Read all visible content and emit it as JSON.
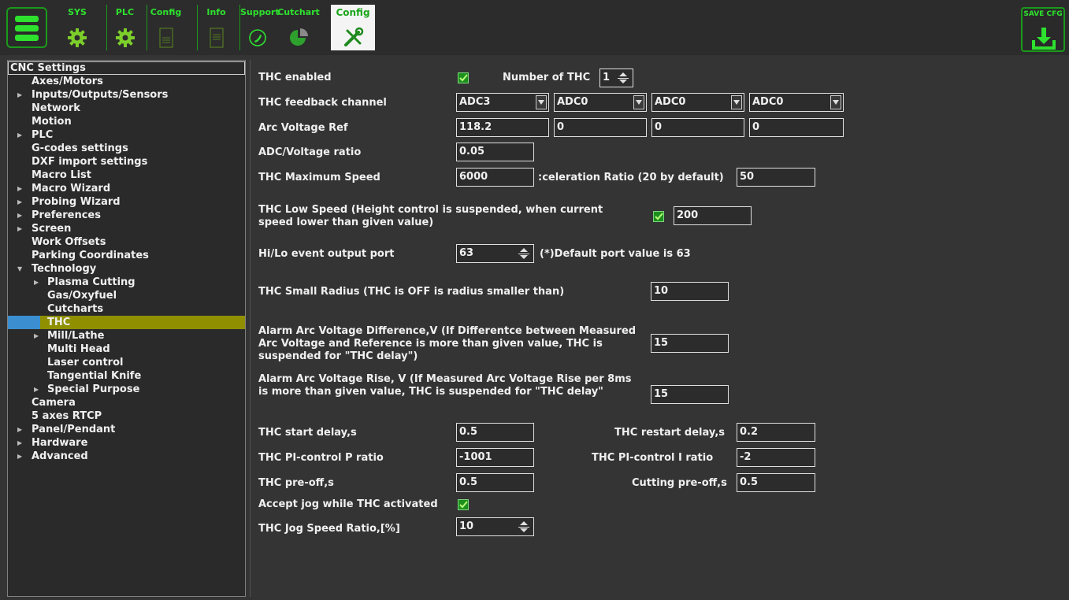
{
  "toolbar": {
    "tabs": [
      {
        "label": "SYS",
        "icon": "gear-icon"
      },
      {
        "label": "PLC",
        "icon": "gear-icon"
      },
      {
        "label": "Config",
        "icon": "document-icon"
      },
      {
        "label": "Info",
        "icon": "document-icon"
      },
      {
        "label": "Support",
        "icon": "phone-icon"
      },
      {
        "label": "Cutchart",
        "icon": "pie-chart-icon"
      },
      {
        "label": "Config",
        "icon": "tools-icon",
        "active": true
      }
    ],
    "save_label": "SAVE CFG"
  },
  "sidebar": {
    "items": [
      {
        "label": "CNC Settings"
      },
      {
        "label": "Axes/Motors"
      },
      {
        "label": "Inputs/Outputs/Sensors"
      },
      {
        "label": "Network"
      },
      {
        "label": "Motion"
      },
      {
        "label": "PLC"
      },
      {
        "label": "G-codes settings"
      },
      {
        "label": "DXF import settings"
      },
      {
        "label": "Macro List"
      },
      {
        "label": "Macro Wizard"
      },
      {
        "label": "Probing Wizard"
      },
      {
        "label": "Preferences"
      },
      {
        "label": "Screen"
      },
      {
        "label": "Work Offsets"
      },
      {
        "label": "Parking Coordinates"
      },
      {
        "label": "Technology"
      },
      {
        "label": "Plasma Cutting"
      },
      {
        "label": "Gas/Oxyfuel"
      },
      {
        "label": "Cutcharts"
      },
      {
        "label": "THC"
      },
      {
        "label": "Mill/Lathe"
      },
      {
        "label": "Multi Head"
      },
      {
        "label": "Laser control"
      },
      {
        "label": "Tangential Knife"
      },
      {
        "label": "Special Purpose"
      },
      {
        "label": "Camera"
      },
      {
        "label": "5 axes RTCP"
      },
      {
        "label": "Panel/Pendant"
      },
      {
        "label": "Hardware"
      },
      {
        "label": "Advanced"
      }
    ]
  },
  "thc": {
    "enabled_label": "THC enabled",
    "enabled": true,
    "number_label": "Number of THC",
    "number_value": "1",
    "feedback_label": "THC feedback channel",
    "feedback_channels": [
      "ADC3",
      "ADC0",
      "ADC0",
      "ADC0"
    ],
    "arc_ref_label": "Arc Voltage Ref",
    "arc_refs": [
      "118.2",
      "0",
      "0",
      "0"
    ],
    "adc_ratio_label": "ADC/Voltage ratio",
    "adc_ratio": "0.05",
    "max_speed_label": "THC Maximum Speed",
    "max_speed": "6000",
    "accel_label": ":celeration Ratio (20 by default)",
    "accel_value": "50",
    "low_speed_label": "THC Low Speed (Height control is suspended, when current speed lower than given value)",
    "low_speed_enabled": true,
    "low_speed": "200",
    "hilo_label": "Hi/Lo event output port",
    "hilo_value": "63",
    "hilo_note": "(*)Default port value is 63",
    "small_radius_label": "THC Small Radius (THC is OFF is radius smaller than)",
    "small_radius": "10",
    "alarm_diff_label": "Alarm Arc Voltage Difference,V (If Differentce between Measured Arc Voltage and Reference is more than given value, THC is suspended for \"THC delay\")",
    "alarm_diff": "15",
    "alarm_rise_label": "Alarm Arc Voltage Rise, V (If Measured Arc Voltage Rise per 8ms is more than given value, THC is suspended for \"THC delay\"",
    "alarm_rise": "15",
    "start_delay_label": "THC start delay,s",
    "start_delay": "0.5",
    "restart_delay_label": "THC restart delay,s",
    "restart_delay": "0.2",
    "pi_p_label": "THC PI-control P ratio",
    "pi_p": "-1001",
    "pi_i_label": "THC PI-control I ratio",
    "pi_i": "-2",
    "preoff_label": "THC pre-off,s",
    "preoff": "0.5",
    "cut_preoff_label": "Cutting pre-off,s",
    "cut_preoff": "0.5",
    "accept_jog_label": "Accept jog while THC activated",
    "accept_jog": true,
    "jog_ratio_label": "THC Jog Speed Ratio,[%]",
    "jog_ratio": "10"
  },
  "colors": {
    "accent": "#2ee12e",
    "selection": "#8f8f00",
    "selection_marker": "#3b8fd0",
    "panel": "#343434"
  }
}
